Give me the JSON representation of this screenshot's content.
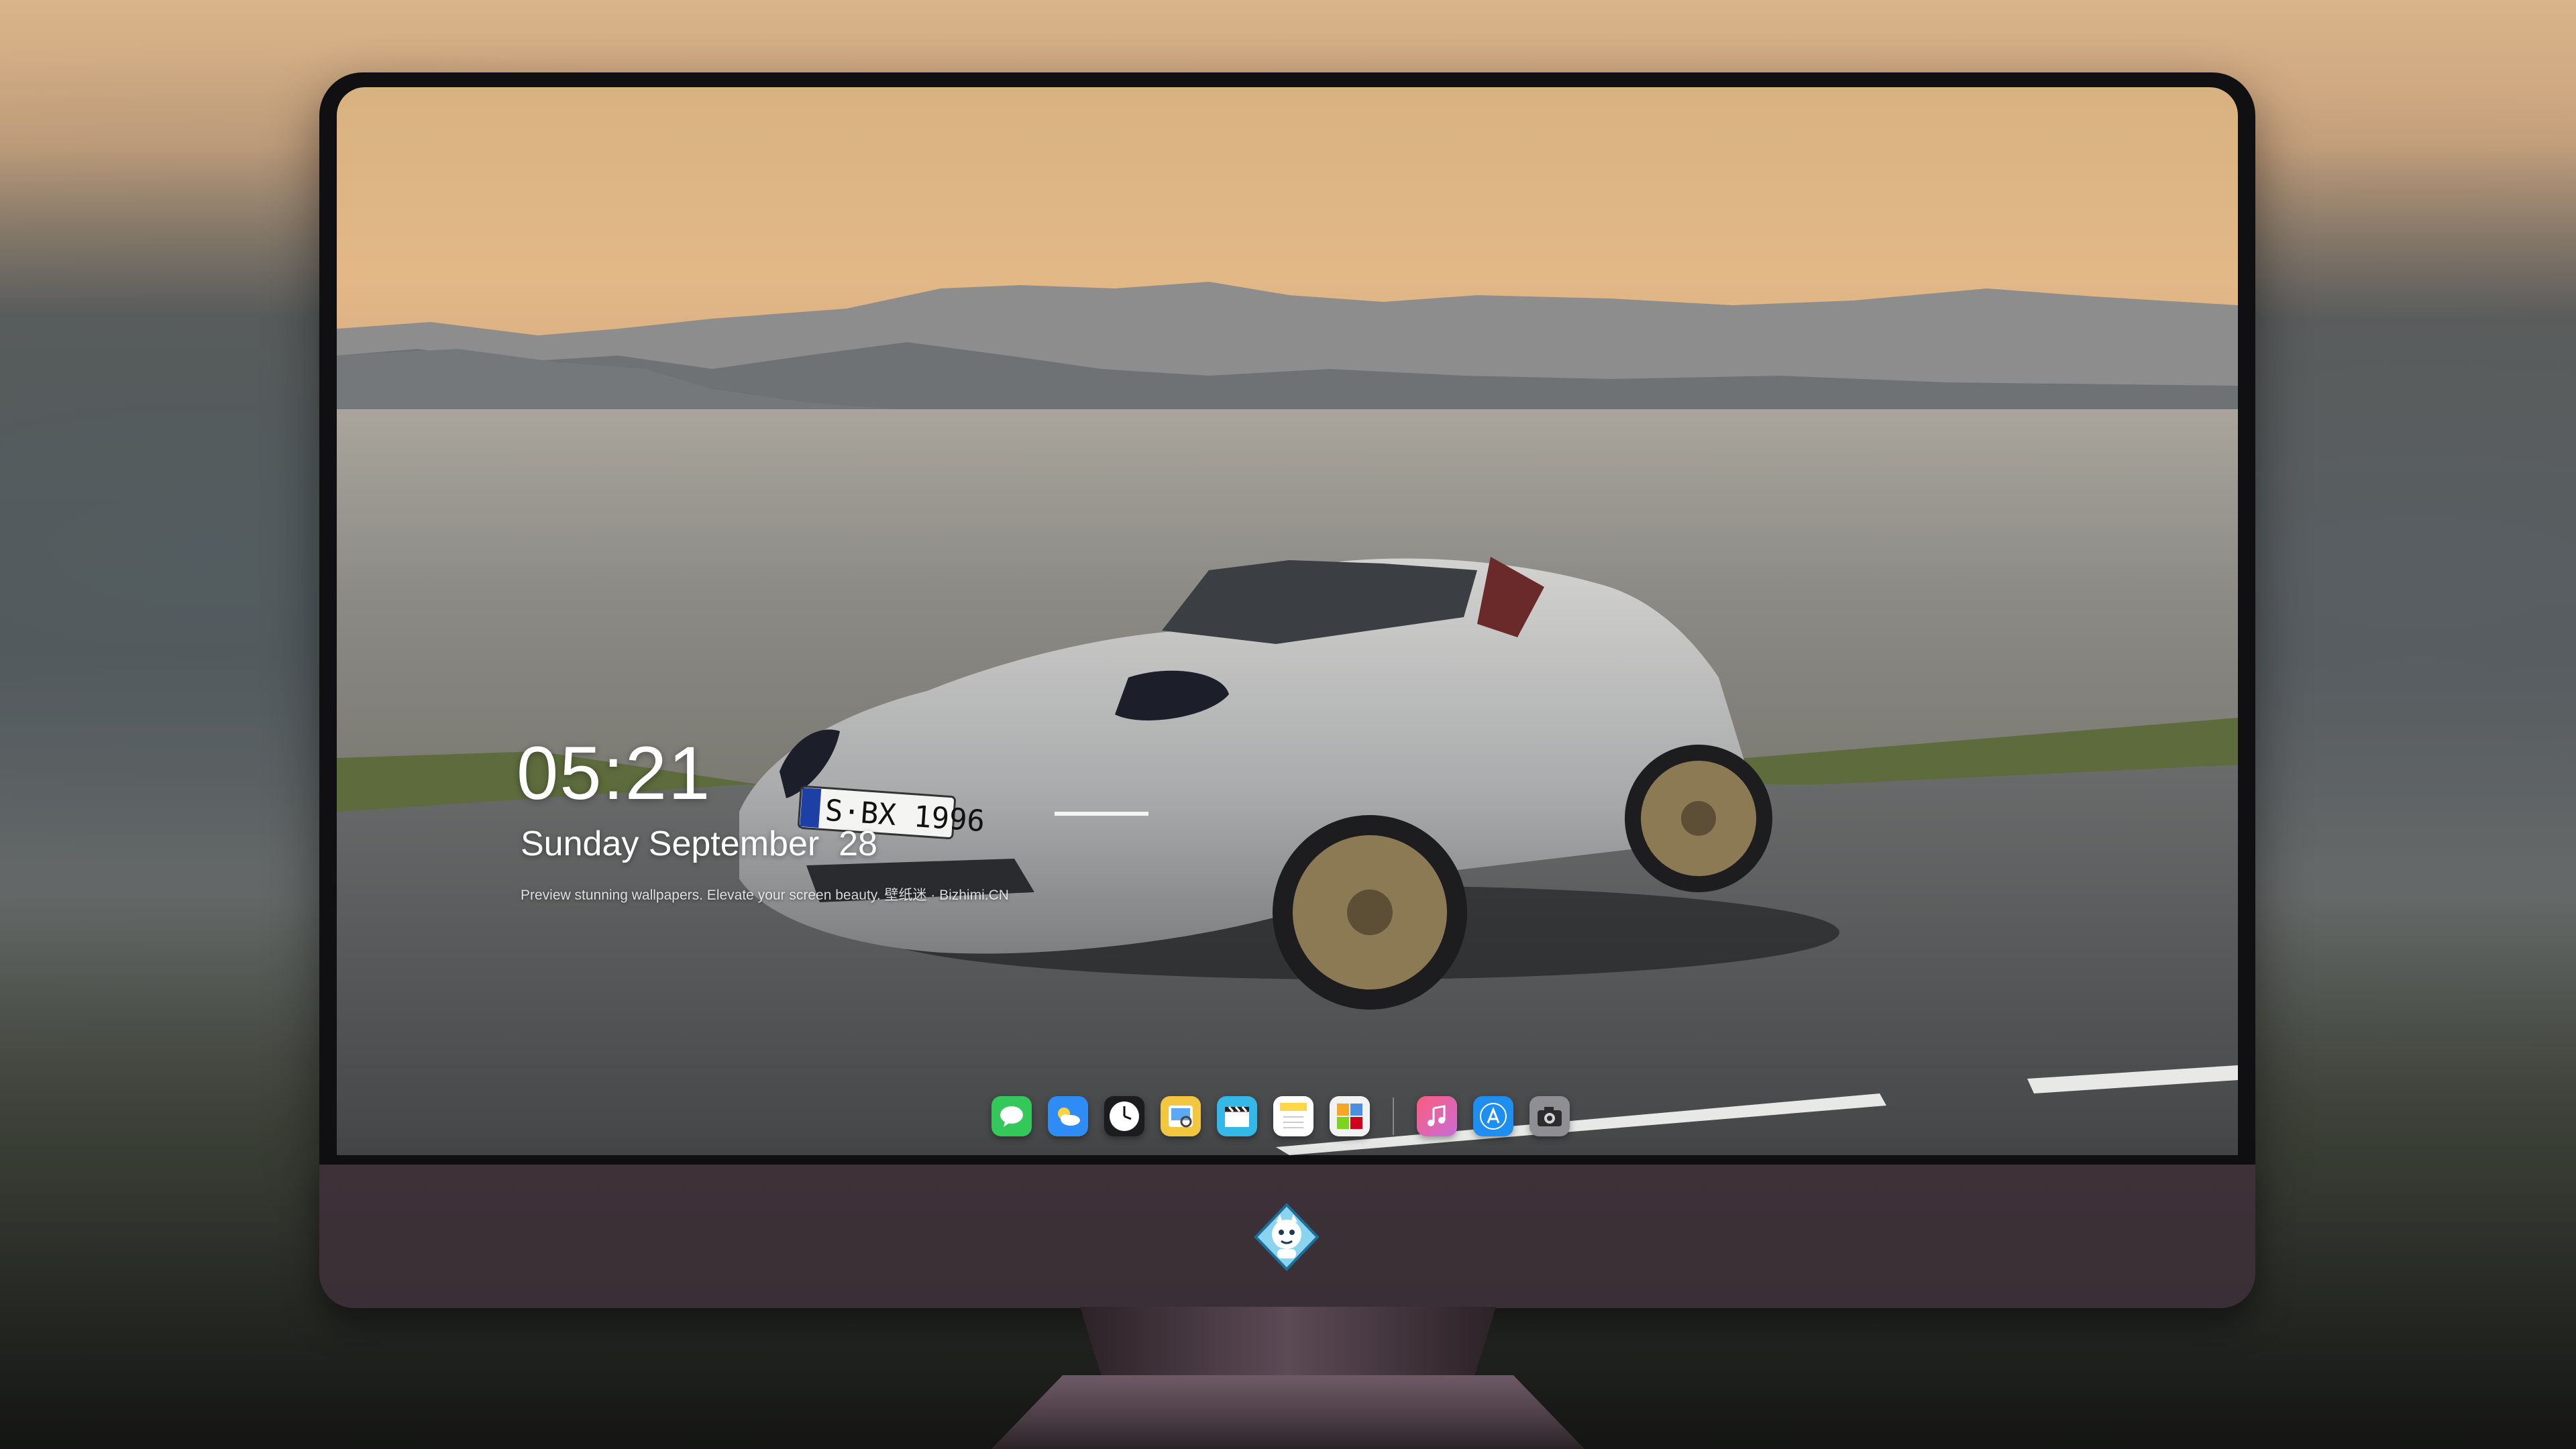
{
  "lock_screen": {
    "time": "05:21",
    "date": "Sunday September  28",
    "caption": "Preview stunning wallpapers. Elevate your screen beauty. 壁纸迷 · Bizhimi.CN"
  },
  "wallpaper": {
    "license_plate": "S·BX 1996"
  },
  "dock": {
    "apps": [
      {
        "name": "messages-icon",
        "color": "#34c759"
      },
      {
        "name": "weather-icon",
        "color": "#2f8cf5"
      },
      {
        "name": "clock-icon",
        "color": "#1c1c1e"
      },
      {
        "name": "preview-icon",
        "color": "#f3c63f"
      },
      {
        "name": "clapperboard-icon",
        "color": "#34b8e8"
      },
      {
        "name": "notes-icon",
        "color": "#ffd84a"
      },
      {
        "name": "photos-gallery-icon",
        "color": "#f2f2f2"
      },
      {
        "name": "music-icon",
        "color": "#fa57c1"
      },
      {
        "name": "app-store-icon",
        "color": "#1f8ef1"
      },
      {
        "name": "camera-icon",
        "color": "#8e8e93"
      }
    ]
  },
  "colors": {
    "sky": "#e0b686",
    "sea": "#8f8f8a",
    "road": "#5a5b5d",
    "car": "#b8b9bb",
    "chin": "#3c3036"
  }
}
